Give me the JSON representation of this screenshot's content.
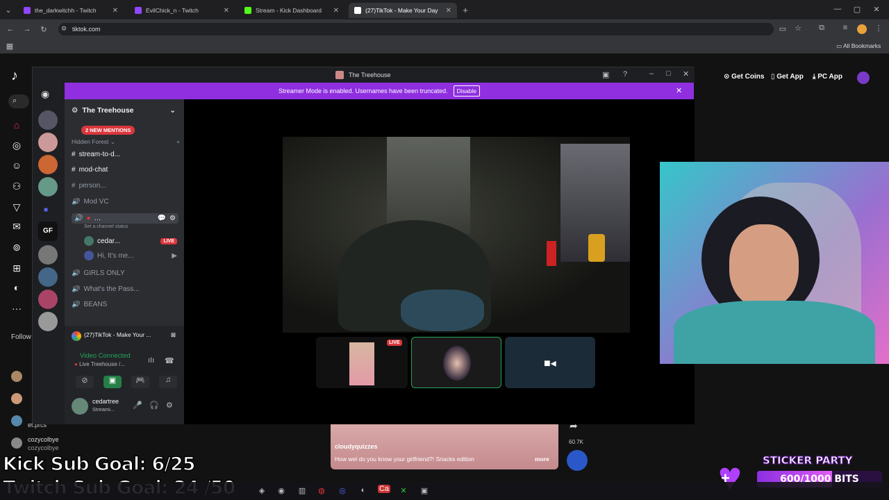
{
  "browser": {
    "tabs": [
      {
        "label": "the_darkwitchh - Twitch",
        "color": "#9146ff"
      },
      {
        "label": "EvilChick_n - Twitch",
        "color": "#9146ff"
      },
      {
        "label": "Stream - Kick Dashboard",
        "color": "#53fc18"
      },
      {
        "label": "(27)TikTok - Make Your Day",
        "color": "#ffffff"
      }
    ],
    "url": "tiktok.com",
    "bookmarks_label": "All Bookmarks"
  },
  "tiktok": {
    "buttons": {
      "coins": "Get Coins",
      "app": "Get App",
      "pc": "PC App"
    },
    "following_label": "Follow",
    "users": [
      "et.prcs",
      "cozycolbye",
      "cozycolbye"
    ],
    "video_user": "cloudyquizzes",
    "video_caption": "How wel do you know your girlfriend?! Snacks edition",
    "more": "more",
    "share_count": "60.7K"
  },
  "discord": {
    "window_title": "The Treehouse",
    "banner_text": "Streamer Mode is enabled. Usernames have been truncated.",
    "banner_button": "Disable",
    "server_name": "The Treehouse",
    "mentions": "2 NEW MENTIONS",
    "category": "Hidden Forest",
    "channels": [
      {
        "name": "stream-to-d...",
        "icon": "#",
        "bright": true
      },
      {
        "name": "mod-chat",
        "icon": "#",
        "bright": true
      },
      {
        "name": "person...",
        "icon": "#",
        "bright": false
      },
      {
        "name": "Mod VC",
        "icon": "voice",
        "bright": false
      }
    ],
    "voice_status": "Set a channel status",
    "voice_members": [
      {
        "name": "cedar...",
        "badge": "LIVE"
      },
      {
        "name": "Hi, It's me...",
        "badge": ""
      }
    ],
    "more_channels": [
      "GIRLS ONLY",
      "What's the Pass...",
      "BEANS"
    ],
    "stream_app": "(27)TikTok - Make Your ...",
    "voice_connected": "Video Connected",
    "voice_channel": "Live Treehouse /...",
    "user_name": "cedartree",
    "user_status": "Streami...",
    "live_badge": "LIVE"
  },
  "overlay": {
    "kick_goal": "Kick Sub Goal: 6/25",
    "twitch_goal": "Twitch Sub Goal: 24 /50",
    "sticker_title": "STICKER PARTY",
    "bits_text": "600/1000 BITS",
    "bits_progress": 0.6
  }
}
